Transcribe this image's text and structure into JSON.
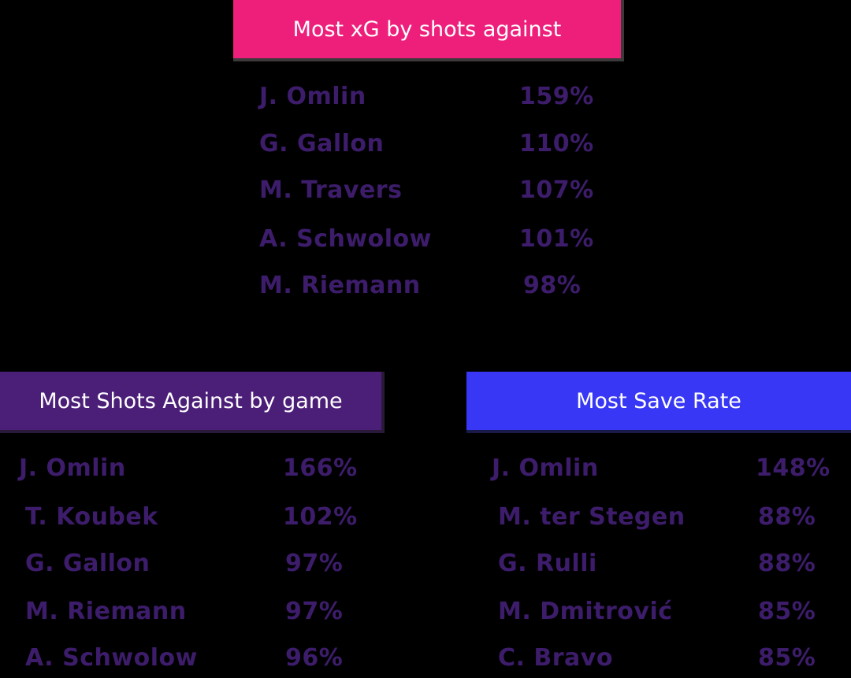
{
  "colors": {
    "background": "#000000",
    "top_header": "#ee1f7b",
    "left_header": "#4b1e78",
    "right_header": "#3737f5",
    "row_text": "#3d1d6b"
  },
  "top_section": {
    "title": "Most xG by shots against",
    "rows": [
      {
        "name": "J. Omlin",
        "value": "159%"
      },
      {
        "name": "G. Gallon",
        "value": "110%"
      },
      {
        "name": "M. Travers",
        "value": "107%"
      },
      {
        "name": "A. Schwolow",
        "value": "101%"
      },
      {
        "name": "M. Riemann",
        "value": "98%"
      }
    ]
  },
  "left_section": {
    "title": "Most Shots Against by game",
    "rows": [
      {
        "name": "J. Omlin",
        "value": "166%"
      },
      {
        "name": "T. Koubek",
        "value": "102%"
      },
      {
        "name": "G. Gallon",
        "value": "97%"
      },
      {
        "name": "M. Riemann",
        "value": "97%"
      },
      {
        "name": "A. Schwolow",
        "value": "96%"
      }
    ]
  },
  "right_section": {
    "title": "Most Save Rate",
    "rows": [
      {
        "name": "J. Omlin",
        "value": "148%"
      },
      {
        "name": "M. ter Stegen",
        "value": "88%"
      },
      {
        "name": "G. Rulli",
        "value": "88%"
      },
      {
        "name": "M. Dmitrović",
        "value": "85%"
      },
      {
        "name": "C. Bravo",
        "value": "85%"
      }
    ]
  }
}
